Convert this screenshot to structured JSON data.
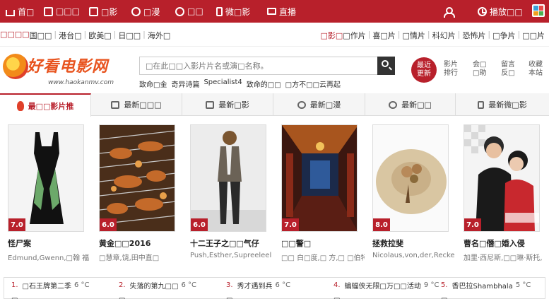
{
  "topnav": {
    "items": [
      {
        "label": "首□",
        "icon": "home-icon"
      },
      {
        "label": "□□□",
        "icon": "tv-icon"
      },
      {
        "label": "□影",
        "icon": "film-icon"
      },
      {
        "label": "□漫",
        "icon": "anime-icon"
      },
      {
        "label": "□□",
        "icon": "disc-icon"
      },
      {
        "label": "微□影",
        "icon": "phone-icon"
      },
      {
        "label": "直播",
        "icon": "monitor-icon"
      }
    ],
    "history_label": "播放□□"
  },
  "catbar": {
    "left_highlight": "□□□□",
    "left": [
      "国□□",
      "港台□",
      "欧美□",
      "日□□",
      "海外□"
    ],
    "right_highlight": "□影□",
    "right": [
      "□作片",
      "喜□片",
      "□情片",
      "科幻片",
      "恐怖片",
      "□争片",
      "□□片"
    ]
  },
  "header": {
    "logo_text": "好看电影网",
    "logo_url": "www.haokanmv.com",
    "search_placeholder": "□在此□□入影片片名或演□名称。",
    "hotwords": [
      "致命□金",
      "奇异诗篇",
      "Specialist4",
      "致命的□□",
      "□方不□□云再起"
    ],
    "recent_line1": "最近",
    "recent_line2": "更新",
    "tools": [
      {
        "l1": "影片",
        "l2": "排行"
      },
      {
        "l1": "会□",
        "l2": "□助"
      },
      {
        "l1": "留言",
        "l2": "反□"
      },
      {
        "l1": "收藏",
        "l2": "本站"
      }
    ]
  },
  "tabs": [
    {
      "label": "最□□影片推"
    },
    {
      "label": "最新□□□"
    },
    {
      "label": "最新□影"
    },
    {
      "label": "最新□漫"
    },
    {
      "label": "最新□□"
    },
    {
      "label": "最新微□影"
    }
  ],
  "movies": [
    {
      "title": "怪尸案",
      "cast": "Edmund,Gwenn,□翰 福",
      "score": "7.0"
    },
    {
      "title": "黄金□□2016",
      "cast": "□慧章,饶,田中直□",
      "score": "6.0"
    },
    {
      "title": "十二王子之□□气仔",
      "cast": "Push,Esther,Supreeleel",
      "score": "6.0"
    },
    {
      "title": "□□警□",
      "cast": "□□ 白□度,□ 方,□ □伯特",
      "score": "7.0"
    },
    {
      "title": "拯救拉斐",
      "cast": "Nicolaus,von,der,Recke",
      "score": "8.0"
    },
    {
      "title": "曹名□僭□婚入侵",
      "cast": "加里·西尼斯,□□琳·斯托,",
      "score": "7.0"
    }
  ],
  "hotlist": [
    {
      "n": "1.",
      "title": "□石王牌第二季",
      "temp": "6 °C"
    },
    {
      "n": "2.",
      "title": "失落的第九□□",
      "temp": "6 °C"
    },
    {
      "n": "3.",
      "title": "秀才遇到兵",
      "temp": "6 °C"
    },
    {
      "n": "4.",
      "title": "蝙蝠侠无限□万□□活动",
      "temp": "9 °C"
    },
    {
      "n": "5.",
      "title": "香巴拉Shambhala",
      "temp": "5 °C"
    }
  ],
  "hotlist_row2": [
    "□",
    "□",
    "□",
    "□",
    "□"
  ]
}
